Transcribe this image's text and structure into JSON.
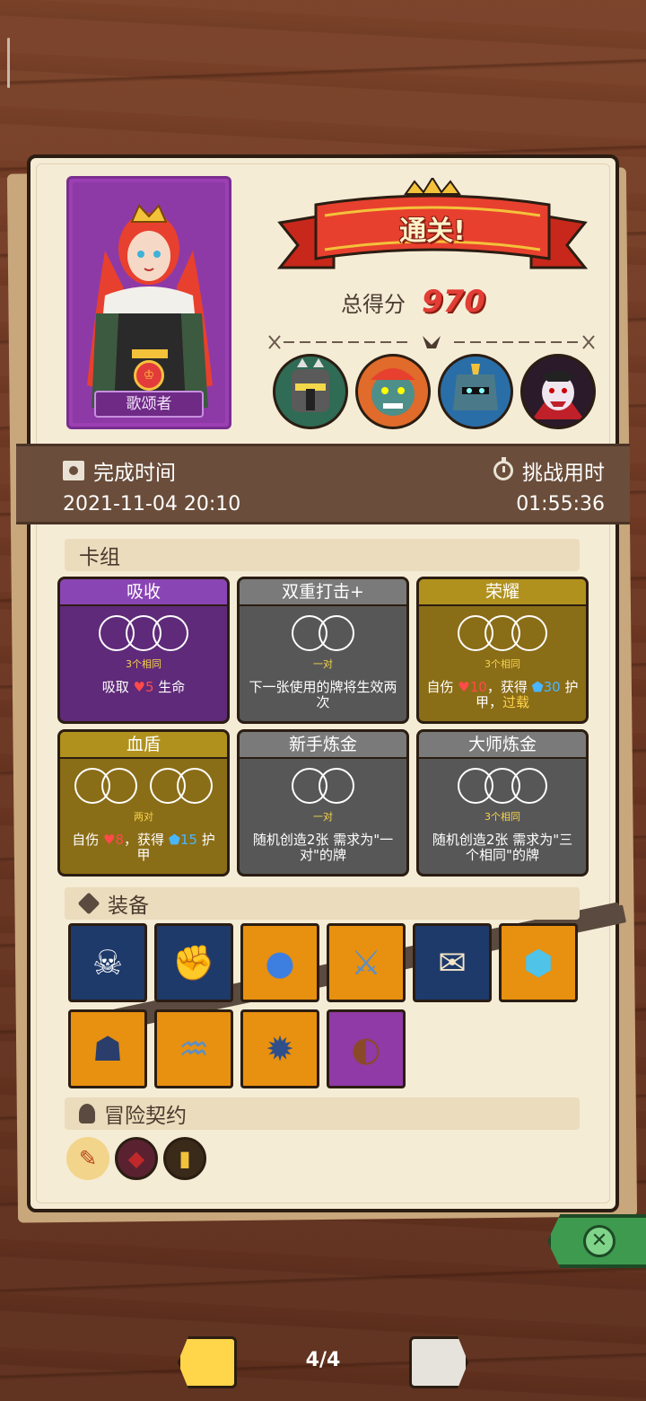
{
  "hero": {
    "name": "歌颂者",
    "emblem": "♔"
  },
  "result": {
    "banner": "通关!",
    "score_label": "总得分",
    "score": "970"
  },
  "bosses": [
    "armored-knight",
    "ogre",
    "iron-golem",
    "vampire"
  ],
  "info": {
    "finish_label": "完成时间",
    "finish_value": "2021-11-04 20:10",
    "duration_label": "挑战用时",
    "duration_value": "01:55:36"
  },
  "sections": {
    "deck": "卡组",
    "equipment": "装备",
    "contracts": "冒险契约"
  },
  "cards": [
    {
      "title": "吸收",
      "type": "3个相同",
      "desc_a": "吸取 ",
      "desc_b": "5",
      "desc_c": " 生命",
      "color": "#5f2a7a"
    },
    {
      "title": "双重打击+",
      "type": "一对",
      "desc": "下一张使用的牌将生效两次",
      "color": "#575757"
    },
    {
      "title": "荣耀",
      "type": "3个相同",
      "desc_a": "自伤 ",
      "desc_b": "10",
      "desc_c": "，获得 ",
      "desc_d": "30",
      "desc_e": " 护甲，",
      "desc_f": "过载",
      "color": "#8a6d17"
    },
    {
      "title": "血盾",
      "type": "两对",
      "desc_a": "自伤 ",
      "desc_b": "8",
      "desc_c": "，获得 ",
      "desc_d": "15",
      "desc_e": " 护甲",
      "color": "#8a6d17"
    },
    {
      "title": "新手炼金",
      "type": "一对",
      "desc": "随机创造2张 需求为\"一对\"的牌",
      "color": "#575757"
    },
    {
      "title": "大师炼金",
      "type": "3个相同",
      "desc": "随机创造2张 需求为\"三个相同\"的牌",
      "color": "#575757"
    }
  ],
  "equipment": [
    {
      "icon": "skull-helmet-icon",
      "glyph": "☠",
      "bg": "blue"
    },
    {
      "icon": "gauntlet-icon",
      "glyph": "✊",
      "bg": "blue"
    },
    {
      "icon": "slime-icon",
      "glyph": "●",
      "bg": "orange"
    },
    {
      "icon": "saw-blade-icon",
      "glyph": "⚔",
      "bg": "orange"
    },
    {
      "icon": "scroll-icon",
      "glyph": "✉",
      "bg": "blue"
    },
    {
      "icon": "crystal-shield-icon",
      "glyph": "⬢",
      "bg": "orange"
    },
    {
      "icon": "plague-mask-icon",
      "glyph": "☗",
      "bg": "orange"
    },
    {
      "icon": "horn-icon",
      "glyph": "♒",
      "bg": "orange"
    },
    {
      "icon": "spiked-ball-icon",
      "glyph": "✹",
      "bg": "orange"
    },
    {
      "icon": "leather-shield-icon",
      "glyph": "◐",
      "bg": "purple"
    }
  ],
  "contracts": [
    {
      "icon": "contract-scroll-icon",
      "glyph": "✎"
    },
    {
      "icon": "contract-cube-icon",
      "glyph": "◆"
    },
    {
      "icon": "contract-totem-icon",
      "glyph": "▮"
    }
  ],
  "pager": {
    "label": "4/4"
  },
  "colors": {
    "paper": "#f5ecd6",
    "band": "#6a4d3a",
    "score_red": "#e23d36",
    "close_green": "#3d9a4e"
  }
}
